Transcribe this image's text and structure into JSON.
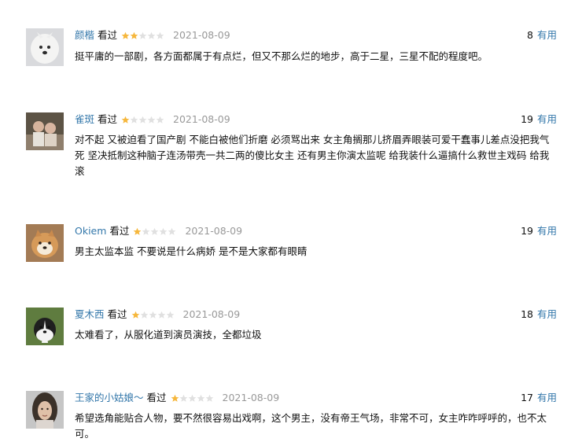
{
  "reviews": [
    {
      "user": "颜楷",
      "status": "看过",
      "rating": 2,
      "date": "2021-08-09",
      "votes": "8",
      "vote_label": "有用",
      "text": "挺平庸的一部剧，各方面都属于有点烂，但又不那么烂的地步，高于二星，三星不配的程度吧。",
      "avatar_icon": "white-dog-avatar-icon"
    },
    {
      "user": "雀斑",
      "status": "看过",
      "rating": 1,
      "date": "2021-08-09",
      "votes": "19",
      "vote_label": "有用",
      "text": "对不起 又被迫看了国产剧 不能白被他们折磨 必须骂出来 女主角搁那儿挤眉弄眼装可爱干蠢事儿差点没把我气死 坚决抵制这种脑子连汤带壳一共二两的傻比女主 还有男主你演太监呢 给我装什么逼搞什么救世主戏码 给我滚",
      "avatar_icon": "portrait-pair-avatar-icon"
    },
    {
      "user": "Okiem",
      "status": "看过",
      "rating": 1,
      "date": "2021-08-09",
      "votes": "19",
      "vote_label": "有用",
      "text": "男主太监本监 不要说是什么病娇 是不是大家都有眼睛",
      "avatar_icon": "shiba-dog-avatar-icon"
    },
    {
      "user": "夏木西",
      "status": "看过",
      "rating": 1,
      "date": "2021-08-09",
      "votes": "18",
      "vote_label": "有用",
      "text": "太难看了，从服化道到演员演技，全都垃圾",
      "avatar_icon": "border-collie-avatar-icon"
    },
    {
      "user": "王家的小姑娘～",
      "status": "看过",
      "rating": 1,
      "date": "2021-08-09",
      "votes": "17",
      "vote_label": "有用",
      "text": "希望选角能贴合人物，要不然很容易出戏啊，这个男主，没有帝王气场，非常不可，女主咋咋呼呼的，也不太可。",
      "avatar_icon": "woman-portrait-avatar-icon"
    }
  ],
  "colors": {
    "link": "#3377aa",
    "star_filled": "#f6b73c",
    "star_empty": "#e0e0e0",
    "date": "#999999"
  }
}
